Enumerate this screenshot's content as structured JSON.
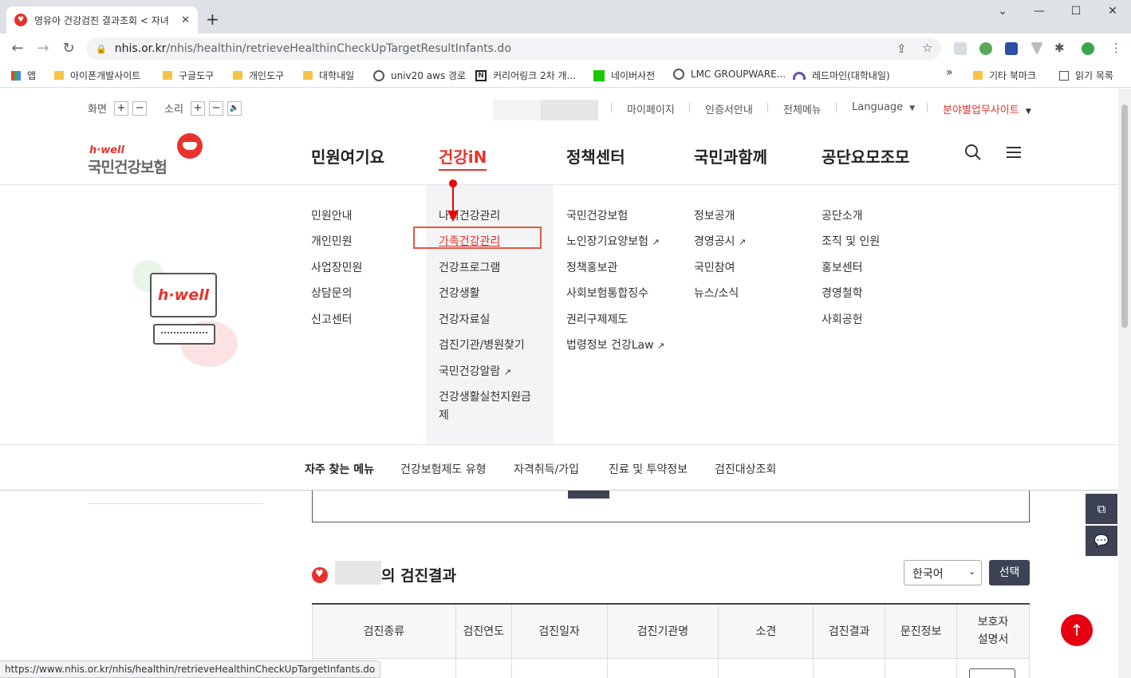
{
  "browser": {
    "tab_title": "영유아 건강검진 결과조회 < 자녀",
    "url_domain": "nhis.or.kr",
    "url_path": "/nhis/healthin/retrieveHealthinCheckUpTargetResultInfants.do",
    "status_url": "https://www.nhis.or.kr/nhis/healthin/retrieveHealthinCheckUpTargetInfants.do",
    "bookmarks": [
      "앱",
      "아이폰개발사이트",
      "구글도구",
      "개인도구",
      "대학내일",
      "univ20 aws 경로",
      "커리어링크 2차 개...",
      "네이버사전",
      "LMC GROUPWARE...",
      "레드마인(대학내일)"
    ],
    "bookmarks_right": [
      "기타 북마크",
      "읽기 목록"
    ]
  },
  "util": {
    "screen_label": "화면",
    "sound_label": "소리",
    "plus": "+",
    "minus": "−",
    "links": [
      "마이페이지",
      "인증서안내",
      "전체메뉴",
      "Language"
    ],
    "site_select": "분야별업무사이트"
  },
  "logo": {
    "small": "h·well",
    "main": "국민건강보험"
  },
  "gnb": [
    "민원여기요",
    "건강iN",
    "정책센터",
    "국민과함께",
    "공단요모조모"
  ],
  "mega": {
    "promo_text": "h·well",
    "col1": [
      "민원안내",
      "개인민원",
      "사업장민원",
      "상담문의",
      "신고센터"
    ],
    "col2": [
      "나의건강관리",
      "가족건강관리",
      "건강프로그램",
      "건강생활",
      "건강자료실",
      "검진기관/병원찾기",
      "국민건강알람",
      "건강생활실천지원금제"
    ],
    "col3": [
      "국민건강보험",
      "노인장기요양보험",
      "정책홍보관",
      "사회보험통합징수",
      "권리구제제도",
      "법령정보 건강Law"
    ],
    "col4": [
      "정보공개",
      "경영공시",
      "국민참여",
      "뉴스/소식"
    ],
    "col5": [
      "공단소개",
      "조직 및 인원",
      "홍보센터",
      "경영철학",
      "사회공헌"
    ]
  },
  "quick": {
    "title": "자주 찾는 메뉴",
    "items": [
      "건강보험제도 유형",
      "자격취득/가입",
      "진료 및 투약정보",
      "검진대상조회"
    ]
  },
  "result": {
    "title_suffix": "의 검진결과",
    "lang_value": "한국어",
    "select_btn": "선택",
    "headers": [
      "검진종류",
      "검진연도",
      "검진일자",
      "검진기관명",
      "소견",
      "검진결과",
      "문진정보",
      "보호자\n설명서"
    ]
  },
  "colors": {
    "brand_red": "#e8322c",
    "dark_button": "#3d4354"
  }
}
